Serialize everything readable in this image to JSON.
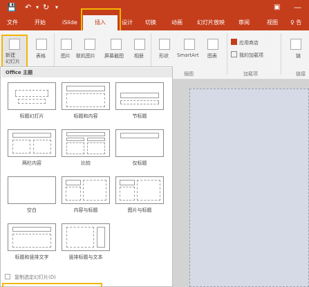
{
  "titlebar": {
    "save_icon": "💾",
    "undo_icon": "↶",
    "redo_icon": "↻",
    "more_icon": "▾",
    "restore_icon": "▣",
    "minimize_icon": "—"
  },
  "tabs": [
    {
      "label": "文件"
    },
    {
      "label": "开始"
    },
    {
      "label": "iSlide"
    },
    {
      "label": "插入"
    },
    {
      "label": "设计"
    },
    {
      "label": "切换"
    },
    {
      "label": "动画"
    },
    {
      "label": "幻灯片放映"
    },
    {
      "label": "审阅"
    },
    {
      "label": "视图"
    },
    {
      "label": "♀ 告"
    }
  ],
  "ribbon": {
    "new_slide_label": "新建\n幻灯片",
    "table_label": "表格",
    "image_label": "图片",
    "online_image_label": "联机图片",
    "screenshot_label": "屏幕截图",
    "album_label": "相册",
    "shapes_label": "形状",
    "smartart_label": "SmartArt",
    "chart_label": "图表",
    "store_label": "应用商店",
    "myaddins_label": "我的加载项",
    "link_label": "链",
    "group_illustrations": "插图",
    "group_addins": "加载项",
    "group_links": "链接"
  },
  "gallery": {
    "header": "Office 主题",
    "layouts": [
      {
        "caption": "标题幻灯片"
      },
      {
        "caption": "标题和内容"
      },
      {
        "caption": "节标题"
      },
      {
        "caption": "两栏内容"
      },
      {
        "caption": "比较"
      },
      {
        "caption": "仅标题"
      },
      {
        "caption": "空白"
      },
      {
        "caption": "内容与标题"
      },
      {
        "caption": "图片与标题"
      },
      {
        "caption": "标题和竖排文字"
      },
      {
        "caption": "竖排标题与文本"
      }
    ],
    "footer_item": "复制选定幻灯片(D)"
  },
  "colors": {
    "accent": "#c43e1c",
    "highlight": "#f5b400"
  }
}
